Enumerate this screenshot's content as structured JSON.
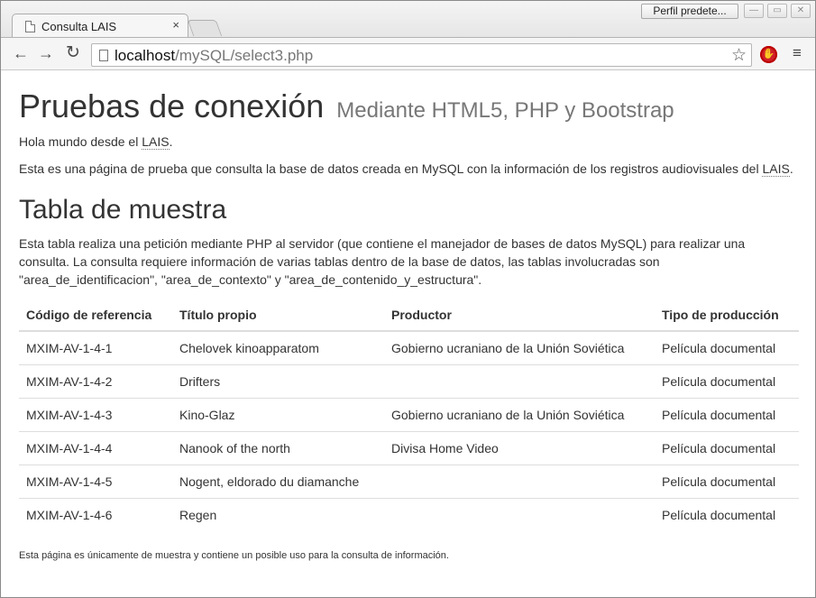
{
  "browser": {
    "tab_title": "Consulta LAIS",
    "tab_close": "×",
    "profile_label": "Perfil predete...",
    "window_min": "—",
    "window_max": "▭",
    "window_close": "✕",
    "url_host": "localhost",
    "url_path": "/mySQL/select3.php",
    "back_glyph": "←",
    "forward_glyph": "→",
    "reload_glyph": "↻",
    "star_glyph": "☆",
    "menu_glyph": "≡",
    "stop_glyph": "✋"
  },
  "page": {
    "title": "Pruebas de conexión",
    "subtitle": "Mediante HTML5, PHP y Bootstrap",
    "hello_prefix": "Hola mundo desde el ",
    "hello_abbr": "LAIS",
    "hello_suffix": ".",
    "intro_prefix": "Esta es una página de prueba que consulta la base de datos creada en MySQL con la información de los registros audiovisuales del ",
    "intro_abbr": "LAIS",
    "intro_suffix": ".",
    "section_title": "Tabla de muestra",
    "description": "Esta tabla realiza una petición mediante PHP al servidor (que contiene el manejador de bases de datos MySQL) para realizar una consulta. La consulta requiere información de varias tablas dentro de la base de datos, las tablas involucradas son \"area_de_identificacion\", \"area_de_contexto\" y \"area_de_contenido_y_estructura\".",
    "footer": "Esta página es únicamente de muestra y contiene un posible uso para la consulta de información."
  },
  "table": {
    "headers": [
      "Código de referencia",
      "Título propio",
      "Productor",
      "Tipo de producción"
    ],
    "rows": [
      [
        "MXIM-AV-1-4-1",
        "Chelovek kinoapparatom",
        "Gobierno ucraniano de la Unión Soviética",
        "Película documental"
      ],
      [
        "MXIM-AV-1-4-2",
        "Drifters",
        "",
        "Película documental"
      ],
      [
        "MXIM-AV-1-4-3",
        "Kino-Glaz",
        "Gobierno ucraniano de la Unión Soviética",
        "Película documental"
      ],
      [
        "MXIM-AV-1-4-4",
        "Nanook of the north",
        "Divisa Home Video",
        "Película documental"
      ],
      [
        "MXIM-AV-1-4-5",
        "Nogent, eldorado du diamanche",
        "",
        "Película documental"
      ],
      [
        "MXIM-AV-1-4-6",
        "Regen",
        "",
        "Película documental"
      ]
    ]
  },
  "colors": {
    "text": "#333333",
    "subtitle": "#777777",
    "table_border": "#dddddd",
    "stop_extension": "#d0202a"
  }
}
